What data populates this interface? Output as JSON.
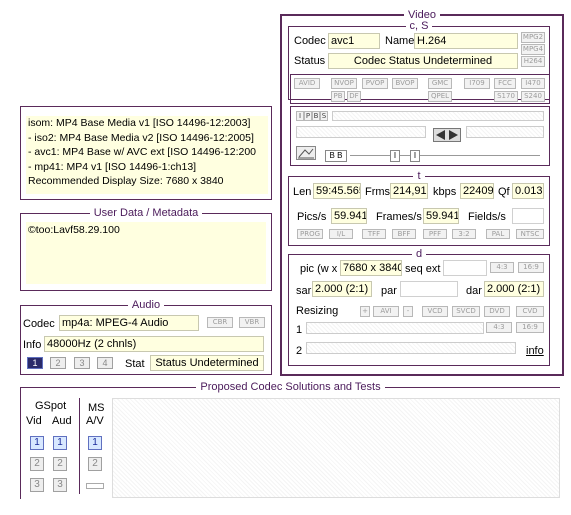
{
  "video": {
    "title": "Video",
    "cs_title": "c, S",
    "codec_label": "Codec",
    "codec_value": "avc1",
    "name_label": "Name",
    "name_value": "H.264",
    "status_label": "Status",
    "status_value": "Codec Status Undetermined",
    "side_buttons": [
      "MPG2",
      "MPG4",
      "H264"
    ],
    "row_buttons_1": [
      "AVID",
      "NVOP",
      "PVOP",
      "BVOP",
      "GMC",
      "I709",
      "FCC",
      "I470"
    ],
    "row_buttons_2": [
      "PB",
      "DF",
      "QPEL",
      "S170",
      "S240"
    ],
    "frame_types": [
      "I",
      "P",
      "B",
      "S"
    ],
    "t_title": "t",
    "len_label": "Len",
    "len_value": "59:45.565",
    "frms_label": "Frms",
    "frms_value": "214,919",
    "kbps_label": "kbps",
    "kbps_value": "22409",
    "qf_label": "Qf",
    "qf_value": "0.013",
    "pics_label": "Pics/s",
    "pics_value": "59.941",
    "frames_label": "Frames/s",
    "frames_value": "59.941",
    "fields_label": "Fields/s",
    "fields_value": "",
    "scan_buttons": [
      "PROG",
      "I/L",
      "TFF",
      "BFF",
      "PFF",
      "3:2",
      "PAL",
      "NTSC"
    ],
    "d_title": "d",
    "pic_label": "pic (w x",
    "pic_value": "7680 x 3840",
    "seq_label": "seq ext",
    "seq_value": "",
    "ar_buttons": [
      "4:3",
      "16:9"
    ],
    "sar_label": "sar",
    "sar_value": "2.000 (2:1)",
    "par_label": "par",
    "par_value": "",
    "dar_label": "dar",
    "dar_value": "2.000 (2:1)",
    "resizing_label": "Resizing",
    "resize_buttons": [
      "+",
      "AVI",
      "-",
      "VCD",
      "SVCD",
      "DVD",
      "CVD"
    ],
    "row1_label": "1",
    "row2_label": "2",
    "info_link": "info"
  },
  "container": {
    "lines": [
      "isom: MP4  Base Media v1 [ISO 14496-12:2003]",
      "- iso2: MP4 Base Media v2 [ISO 14496-12:2005]",
      "- avc1: MP4 Base w/ AVC ext [ISO 14496-12:200",
      "- mp41: MP4 v1 [ISO 14496-1:ch13]",
      "Recommended Display Size: 7680 x 3840"
    ]
  },
  "userdata": {
    "title": "User Data / Metadata",
    "text": "©too:Lavf58.29.100"
  },
  "audio": {
    "title": "Audio",
    "codec_label": "Codec",
    "codec_value": "mp4a: MPEG-4 Audio",
    "cbr": "CBR",
    "vbr": "VBR",
    "info_label": "Info",
    "info_value": "48000Hz  (2 chnls)",
    "tracks": [
      "1",
      "2",
      "3",
      "4"
    ],
    "stat_label": "Stat",
    "stat_value": "Status Undetermined"
  },
  "proposed": {
    "title": "Proposed Codec Solutions and Tests",
    "gspot": "GSpot",
    "vid": "Vid",
    "aud": "Aud",
    "ms": "MS",
    "av": "A/V",
    "vid_nums": [
      "1",
      "2",
      "3"
    ],
    "aud_nums": [
      "1",
      "2",
      "3"
    ],
    "ms_nums": [
      "1",
      "2"
    ]
  }
}
